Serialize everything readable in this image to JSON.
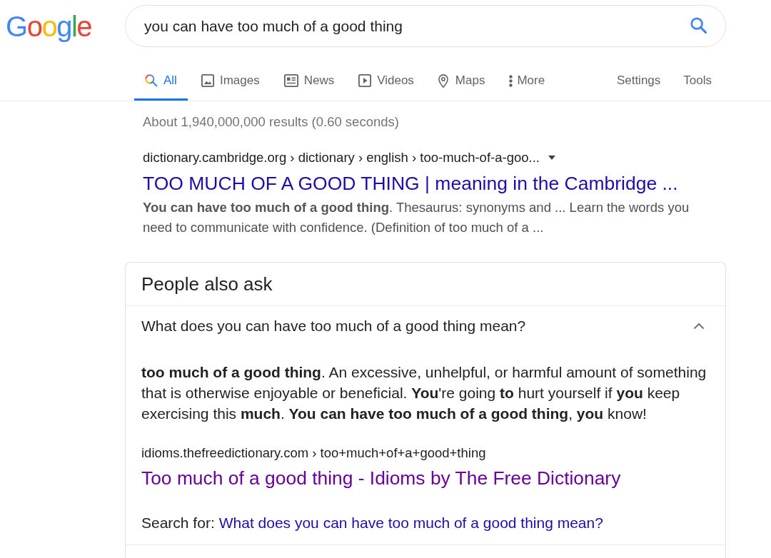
{
  "logo": {
    "text": "Google"
  },
  "search": {
    "value": "you can have too much of a good thing"
  },
  "tabs": [
    {
      "label": "All",
      "selected": true
    },
    {
      "label": "Images",
      "selected": false
    },
    {
      "label": "News",
      "selected": false
    },
    {
      "label": "Videos",
      "selected": false
    },
    {
      "label": "Maps",
      "selected": false
    },
    {
      "label": "More",
      "selected": false
    }
  ],
  "tools": [
    {
      "label": "Settings"
    },
    {
      "label": "Tools"
    }
  ],
  "result_stats": "About 1,940,000,000 results (0.60 seconds)",
  "results": [
    {
      "breadcrumb": "dictionary.cambridge.org › dictionary › english › too-much-of-a-goo...",
      "title": "TOO MUCH OF A GOOD THING | meaning in the Cambridge ...",
      "visited": false,
      "snippet": "**You can have too much of a good thing**. Thesaurus: synonyms and ... Learn the words you need to communicate with confidence. (Definition of too much of a ..."
    }
  ],
  "people_also_ask": {
    "heading": "People also ask",
    "questions": [
      {
        "question": "What does you can have too much of a good thing mean?",
        "expanded": true,
        "answer": "**too much of a good thing**. An excessive, unhelpful, or harmful amount of something that is otherwise enjoyable or beneficial. **You**'re going **to** hurt yourself if **you** keep exercising this **much**. **You can have too much of a good thing**, **you** know!",
        "source_url": "idioms.thefreedictionary.com › too+much+of+a+good+thing",
        "source_title": "Too much of a good thing - Idioms by The Free Dictionary",
        "source_visited": true,
        "search_for_label": "Search for:",
        "search_for_link": "What does you can have too much of a good thing mean?"
      }
    ]
  }
}
